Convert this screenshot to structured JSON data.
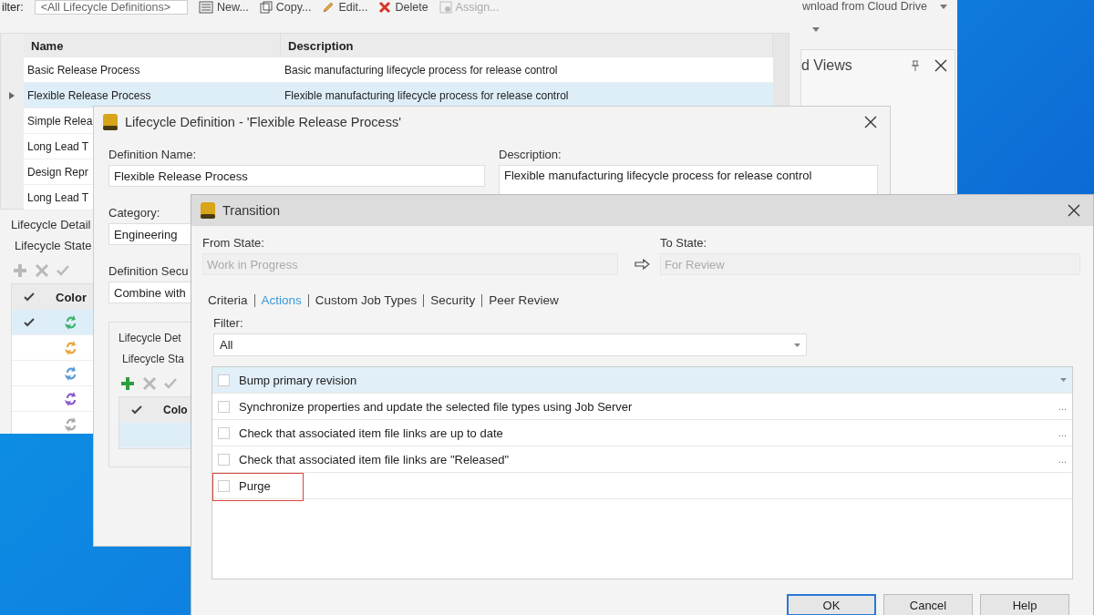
{
  "main_window": {
    "toolbar": {
      "filter_label": "ilter:",
      "filter_value": "<All Lifecycle Definitions>",
      "buttons": [
        {
          "kind": "new",
          "label": "New...",
          "disabled": false
        },
        {
          "kind": "copy",
          "label": "Copy...",
          "disabled": false
        },
        {
          "kind": "edit",
          "label": "Edit...",
          "disabled": false
        },
        {
          "kind": "delete",
          "label": "Delete",
          "disabled": false
        },
        {
          "kind": "assign",
          "label": "Assign...",
          "disabled": true
        }
      ]
    },
    "cloud_button": "wnload from Cloud Drive",
    "definitions": {
      "columns": [
        "Name",
        "Description"
      ],
      "rows": [
        {
          "name": "Basic Release Process",
          "description": "Basic manufacturing lifecycle process for release control",
          "selected": false
        },
        {
          "name": "Flexible Release Process",
          "description": "Flexible manufacturing lifecycle process for release control",
          "selected": true
        },
        {
          "name": "Simple Relea",
          "selected": false
        },
        {
          "name": "Long Lead T",
          "selected": false
        },
        {
          "name": "Design Repr",
          "selected": false
        },
        {
          "name": "Long Lead T",
          "selected": false
        }
      ]
    },
    "side_panel": {
      "title": "d Views"
    },
    "details": {
      "group_title": "Lifecycle Detail",
      "tab": "Lifecycle State",
      "tools": [
        {
          "kind": "add",
          "disabled": true
        },
        {
          "kind": "delete",
          "disabled": true
        },
        {
          "kind": "accept",
          "disabled": true
        }
      ],
      "color_column": "Color",
      "states": [
        {
          "checked": true,
          "selected": true,
          "color": "#3cb46e"
        },
        {
          "checked": false,
          "selected": false,
          "color": "#e9a53c"
        },
        {
          "checked": false,
          "selected": false,
          "color": "#5b9bd5"
        },
        {
          "checked": false,
          "selected": false,
          "color": "#8a5ccb"
        },
        {
          "checked": false,
          "selected": false,
          "color": "#a8a8a8"
        }
      ]
    }
  },
  "definition_dialog": {
    "title": "Lifecycle Definition - 'Flexible Release Process'",
    "name_label": "Definition Name:",
    "name_value": "Flexible Release Process",
    "description_label": "Description:",
    "description_value": "Flexible manufacturing lifecycle process for release control",
    "category_label": "Category:",
    "category_value": "Engineering",
    "security_label": "Definition Secu",
    "security_value": "Combine with",
    "details": {
      "group_title": "Lifecycle Det",
      "tab": "Lifecycle Sta",
      "tools": [
        {
          "kind": "add",
          "disabled": false
        },
        {
          "kind": "delete",
          "disabled": true
        },
        {
          "kind": "accept",
          "disabled": true
        }
      ],
      "color_column": "Colo",
      "states": [
        {
          "checked": false,
          "selected": true
        }
      ]
    }
  },
  "transition": {
    "title": "Transition",
    "from_label": "From State:",
    "from_value": "Work in Progress",
    "to_label": "To State:",
    "to_value": "For Review",
    "tabs": [
      {
        "label": "Criteria",
        "selected": false
      },
      {
        "label": "Actions",
        "selected": true
      },
      {
        "label": "Custom Job Types",
        "selected": false
      },
      {
        "label": "Security",
        "selected": false
      },
      {
        "label": "Peer Review",
        "selected": false
      }
    ],
    "filter_label": "Filter:",
    "filter_value": "All",
    "actions": [
      {
        "kind": "dropdown",
        "label": "Bump primary revision",
        "checked": false,
        "selected": true,
        "highlighted": false
      },
      {
        "kind": "ellipsis",
        "label": "Synchronize properties and update the selected file types using Job Server",
        "more": "...",
        "checked": false,
        "selected": false,
        "highlighted": false
      },
      {
        "kind": "ellipsis",
        "label": "Check that associated item file links are up to date",
        "more": "...",
        "checked": false,
        "selected": false,
        "highlighted": false
      },
      {
        "kind": "ellipsis",
        "label": "Check that associated item file links are \"Released\"",
        "more": "...",
        "checked": false,
        "selected": false,
        "highlighted": false
      },
      {
        "kind": "plain",
        "label": "Purge",
        "checked": false,
        "selected": false,
        "highlighted": true
      }
    ],
    "buttons": [
      {
        "label": "OK",
        "default": true
      },
      {
        "label": "Cancel",
        "default": false
      },
      {
        "label": "Help",
        "default": false
      }
    ]
  }
}
